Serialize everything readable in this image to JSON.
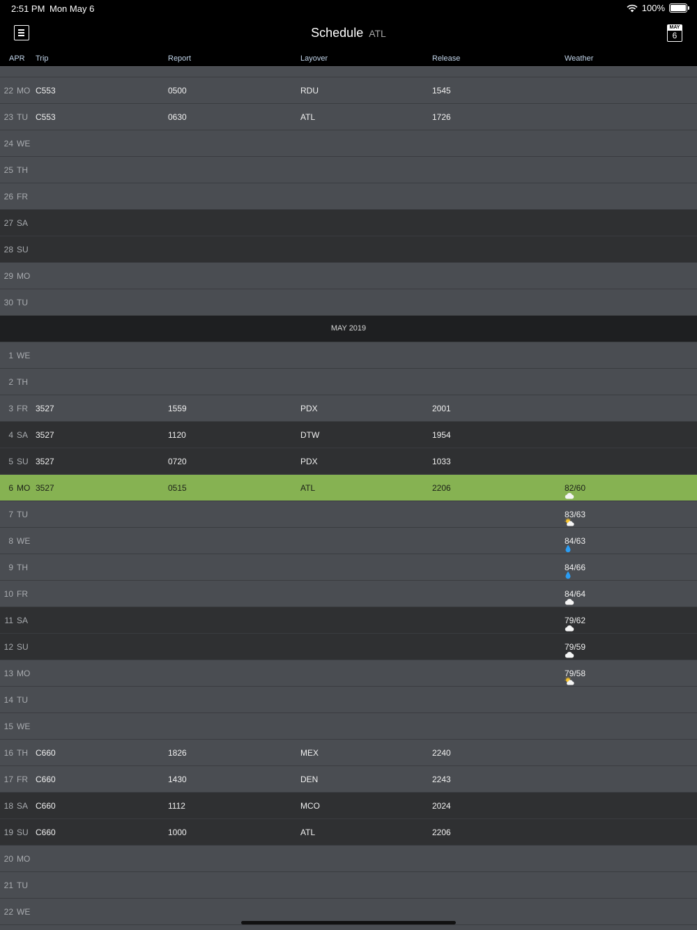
{
  "status": {
    "time": "2:51 PM",
    "date": "Mon May 6",
    "battery": "100%"
  },
  "nav": {
    "title": "Schedule",
    "subtitle": "ATL",
    "calendar_month": "MAY",
    "calendar_day": "6"
  },
  "header": {
    "month": "APR",
    "trip": "Trip",
    "report": "Report",
    "layover": "Layover",
    "release": "Release",
    "weather": "Weather"
  },
  "month_band": "MAY 2019",
  "rows_apr": [
    {
      "day": "22",
      "dow": "MO",
      "trip": "C553",
      "report": "0500",
      "layover": "RDU",
      "release": "1545",
      "weather": "",
      "style": "light"
    },
    {
      "day": "23",
      "dow": "TU",
      "trip": "C553",
      "report": "0630",
      "layover": "ATL",
      "release": "1726",
      "weather": "",
      "style": "light"
    },
    {
      "day": "24",
      "dow": "WE",
      "trip": "",
      "report": "",
      "layover": "",
      "release": "",
      "weather": "",
      "style": "light"
    },
    {
      "day": "25",
      "dow": "TH",
      "trip": "",
      "report": "",
      "layover": "",
      "release": "",
      "weather": "",
      "style": "light"
    },
    {
      "day": "26",
      "dow": "FR",
      "trip": "",
      "report": "",
      "layover": "",
      "release": "",
      "weather": "",
      "style": "light"
    },
    {
      "day": "27",
      "dow": "SA",
      "trip": "",
      "report": "",
      "layover": "",
      "release": "",
      "weather": "",
      "style": "dark"
    },
    {
      "day": "28",
      "dow": "SU",
      "trip": "",
      "report": "",
      "layover": "",
      "release": "",
      "weather": "",
      "style": "dark"
    },
    {
      "day": "29",
      "dow": "MO",
      "trip": "",
      "report": "",
      "layover": "",
      "release": "",
      "weather": "",
      "style": "light"
    },
    {
      "day": "30",
      "dow": "TU",
      "trip": "",
      "report": "",
      "layover": "",
      "release": "",
      "weather": "",
      "style": "light"
    }
  ],
  "rows_may": [
    {
      "day": "1",
      "dow": "WE",
      "trip": "",
      "report": "",
      "layover": "",
      "release": "",
      "weather": "",
      "icon": "",
      "style": "light"
    },
    {
      "day": "2",
      "dow": "TH",
      "trip": "",
      "report": "",
      "layover": "",
      "release": "",
      "weather": "",
      "icon": "",
      "style": "light"
    },
    {
      "day": "3",
      "dow": "FR",
      "trip": "3527",
      "report": "1559",
      "layover": "PDX",
      "release": "2001",
      "weather": "",
      "icon": "",
      "style": "light"
    },
    {
      "day": "4",
      "dow": "SA",
      "trip": "3527",
      "report": "1120",
      "layover": "DTW",
      "release": "1954",
      "weather": "",
      "icon": "",
      "style": "dark"
    },
    {
      "day": "5",
      "dow": "SU",
      "trip": "3527",
      "report": "0720",
      "layover": "PDX",
      "release": "1033",
      "weather": "",
      "icon": "",
      "style": "dark"
    },
    {
      "day": "6",
      "dow": "MO",
      "trip": "3527",
      "report": "0515",
      "layover": "ATL",
      "release": "2206",
      "weather": "82/60",
      "icon": "cloud-icon",
      "style": "today"
    },
    {
      "day": "7",
      "dow": "TU",
      "trip": "",
      "report": "",
      "layover": "",
      "release": "",
      "weather": "83/63",
      "icon": "partly-sunny-icon",
      "style": "light"
    },
    {
      "day": "8",
      "dow": "WE",
      "trip": "",
      "report": "",
      "layover": "",
      "release": "",
      "weather": "84/63",
      "icon": "rain-drop-icon",
      "style": "light"
    },
    {
      "day": "9",
      "dow": "TH",
      "trip": "",
      "report": "",
      "layover": "",
      "release": "",
      "weather": "84/66",
      "icon": "rain-drop-icon",
      "style": "light"
    },
    {
      "day": "10",
      "dow": "FR",
      "trip": "",
      "report": "",
      "layover": "",
      "release": "",
      "weather": "84/64",
      "icon": "cloud-icon",
      "style": "light"
    },
    {
      "day": "11",
      "dow": "SA",
      "trip": "",
      "report": "",
      "layover": "",
      "release": "",
      "weather": "79/62",
      "icon": "cloud-icon",
      "style": "dark"
    },
    {
      "day": "12",
      "dow": "SU",
      "trip": "",
      "report": "",
      "layover": "",
      "release": "",
      "weather": "79/59",
      "icon": "cloud-icon",
      "style": "dark"
    },
    {
      "day": "13",
      "dow": "MO",
      "trip": "",
      "report": "",
      "layover": "",
      "release": "",
      "weather": "79/58",
      "icon": "partly-sunny-icon",
      "style": "light"
    },
    {
      "day": "14",
      "dow": "TU",
      "trip": "",
      "report": "",
      "layover": "",
      "release": "",
      "weather": "",
      "icon": "",
      "style": "light"
    },
    {
      "day": "15",
      "dow": "WE",
      "trip": "",
      "report": "",
      "layover": "",
      "release": "",
      "weather": "",
      "icon": "",
      "style": "light"
    },
    {
      "day": "16",
      "dow": "TH",
      "trip": "C660",
      "report": "1826",
      "layover": "MEX",
      "release": "2240",
      "weather": "",
      "icon": "",
      "style": "light"
    },
    {
      "day": "17",
      "dow": "FR",
      "trip": "C660",
      "report": "1430",
      "layover": "DEN",
      "release": "2243",
      "weather": "",
      "icon": "",
      "style": "light"
    },
    {
      "day": "18",
      "dow": "SA",
      "trip": "C660",
      "report": "1112",
      "layover": "MCO",
      "release": "2024",
      "weather": "",
      "icon": "",
      "style": "dark"
    },
    {
      "day": "19",
      "dow": "SU",
      "trip": "C660",
      "report": "1000",
      "layover": "ATL",
      "release": "2206",
      "weather": "",
      "icon": "",
      "style": "dark"
    },
    {
      "day": "20",
      "dow": "MO",
      "trip": "",
      "report": "",
      "layover": "",
      "release": "",
      "weather": "",
      "icon": "",
      "style": "light"
    },
    {
      "day": "21",
      "dow": "TU",
      "trip": "",
      "report": "",
      "layover": "",
      "release": "",
      "weather": "",
      "icon": "",
      "style": "light"
    },
    {
      "day": "22",
      "dow": "WE",
      "trip": "",
      "report": "",
      "layover": "",
      "release": "",
      "weather": "",
      "icon": "",
      "style": "light"
    }
  ]
}
